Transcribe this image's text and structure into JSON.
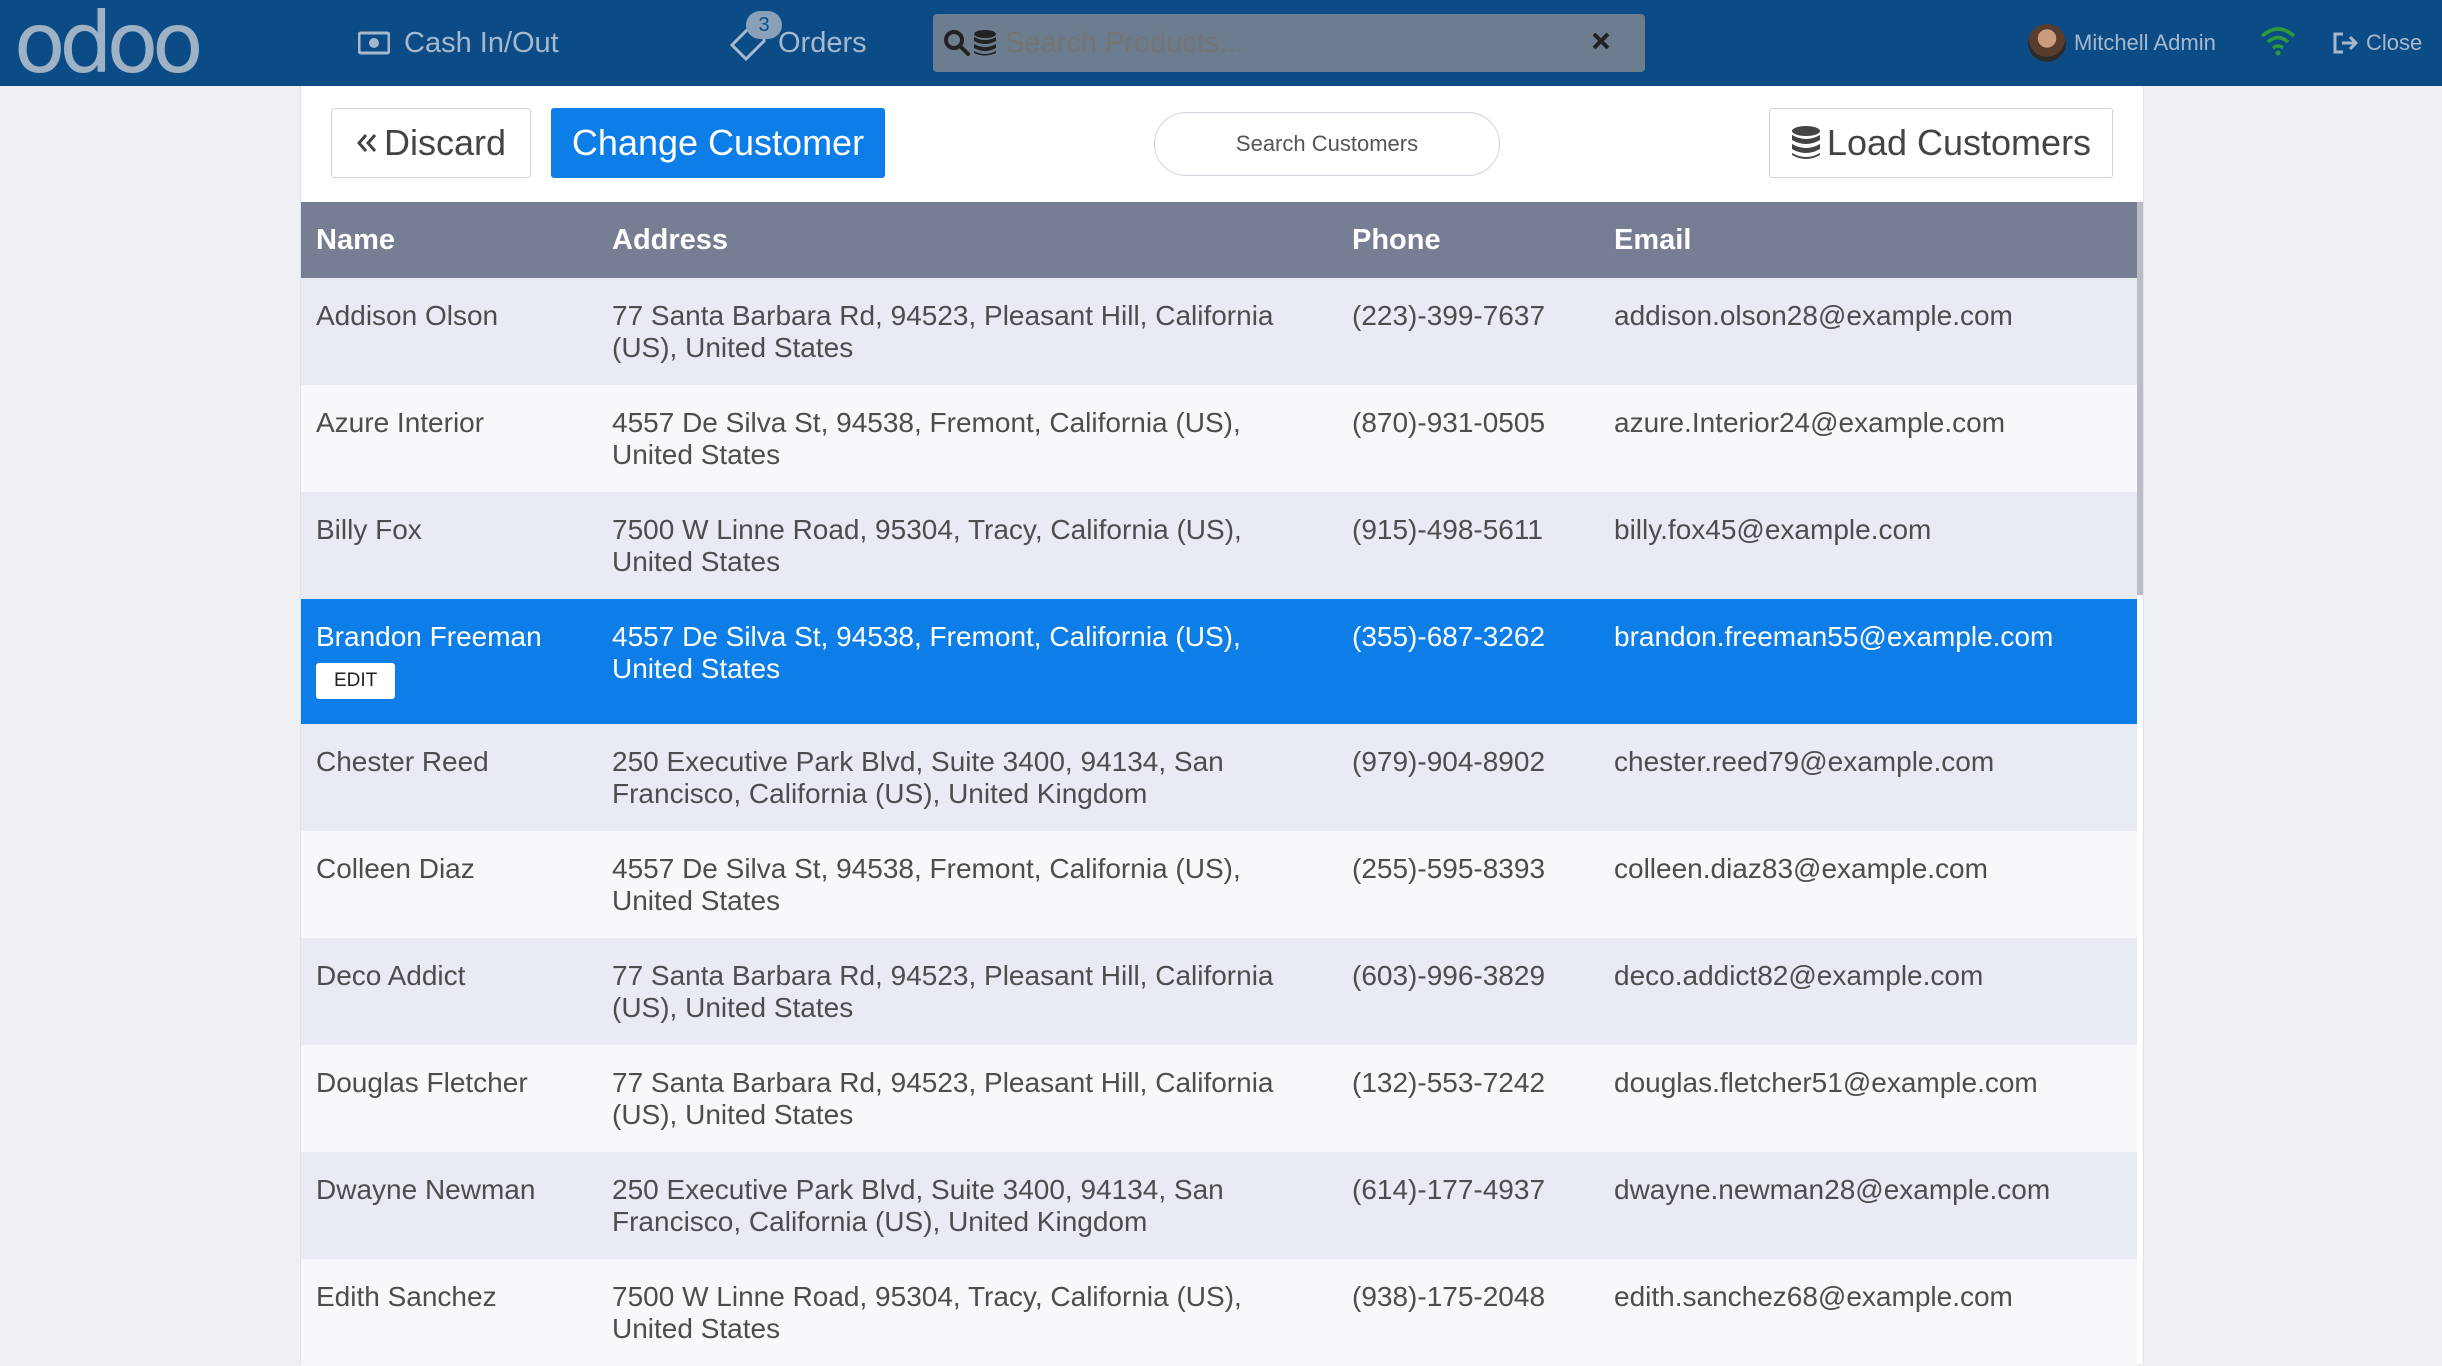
{
  "header": {
    "logo_text": "odoo",
    "cash_label": "Cash In/Out",
    "orders_label": "Orders",
    "orders_count": "3",
    "search_placeholder": "Search Products...",
    "user_name": "Mitchell Admin",
    "close_label": "Close"
  },
  "toolbar": {
    "discard_label": "Discard",
    "change_customer_label": "Change Customer",
    "search_customers_placeholder": "Search Customers",
    "load_customers_label": "Load Customers"
  },
  "table": {
    "columns": [
      "Name",
      "Address",
      "Phone",
      "Email"
    ],
    "rows": [
      {
        "name": "Addison Olson",
        "address": "77 Santa Barbara Rd, 94523, Pleasant Hill, California (US), United States",
        "phone": "(223)-399-7637",
        "email": "addison.olson28@example.com"
      },
      {
        "name": "Azure Interior",
        "address": "4557 De Silva St, 94538, Fremont, California (US), United States",
        "phone": "(870)-931-0505",
        "email": "azure.Interior24@example.com"
      },
      {
        "name": "Billy Fox",
        "address": "7500 W Linne Road, 95304, Tracy, California (US), United States",
        "phone": "(915)-498-5611",
        "email": "billy.fox45@example.com"
      },
      {
        "name": "Brandon Freeman",
        "address": "4557 De Silva St, 94538, Fremont, California (US), United States",
        "phone": "(355)-687-3262",
        "email": "brandon.freeman55@example.com",
        "edit_label": "EDIT"
      },
      {
        "name": "Chester Reed",
        "address": "250 Executive Park Blvd, Suite 3400, 94134, San Francisco, California (US), United Kingdom",
        "phone": "(979)-904-8902",
        "email": "chester.reed79@example.com"
      },
      {
        "name": "Colleen Diaz",
        "address": "4557 De Silva St, 94538, Fremont, California (US), United States",
        "phone": "(255)-595-8393",
        "email": "colleen.diaz83@example.com"
      },
      {
        "name": "Deco Addict",
        "address": "77 Santa Barbara Rd, 94523, Pleasant Hill, California (US), United States",
        "phone": "(603)-996-3829",
        "email": "deco.addict82@example.com"
      },
      {
        "name": "Douglas Fletcher",
        "address": "77 Santa Barbara Rd, 94523, Pleasant Hill, California (US), United States",
        "phone": "(132)-553-7242",
        "email": "douglas.fletcher51@example.com"
      },
      {
        "name": "Dwayne Newman",
        "address": "250 Executive Park Blvd, Suite 3400, 94134, San Francisco, California (US), United Kingdom",
        "phone": "(614)-177-4937",
        "email": "dwayne.newman28@example.com"
      },
      {
        "name": "Edith Sanchez",
        "address": "7500 W Linne Road, 95304, Tracy, California (US), United States",
        "phone": "(938)-175-2048",
        "email": "edith.sanchez68@example.com"
      }
    ]
  },
  "colors": {
    "topbar": "#0b4c86",
    "accent": "#0d7ee8",
    "table_header": "#777d93"
  },
  "icons": [
    "money-icon",
    "tag-icon",
    "search-icon",
    "database-icon",
    "close-icon",
    "wifi-icon",
    "sign-out-icon",
    "double-chevron-left-icon"
  ]
}
